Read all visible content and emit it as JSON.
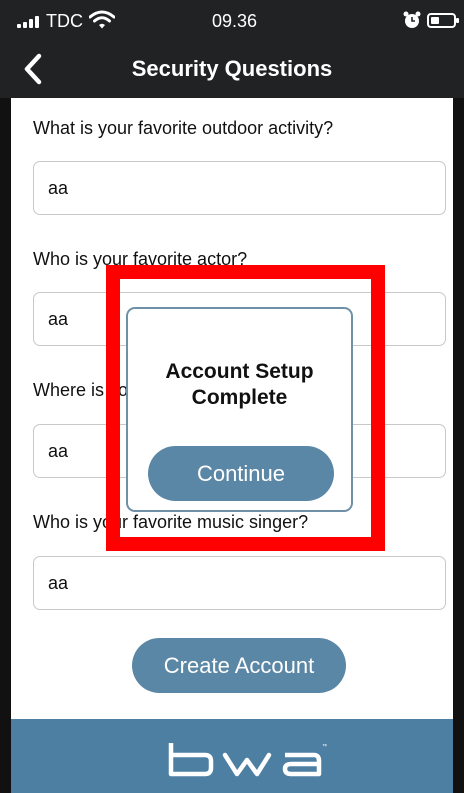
{
  "status_bar": {
    "carrier": "TDC",
    "time": "09.36"
  },
  "header": {
    "title": "Security Questions"
  },
  "questions": [
    {
      "label": "What is your favorite outdoor activity?",
      "answer": "aa"
    },
    {
      "label": "Who is your favorite actor?",
      "answer": "aa"
    },
    {
      "label": "Where is your favorite vacation spot?",
      "answer": "aa"
    },
    {
      "label": "Who is your favorite music singer?",
      "answer": "aa"
    }
  ],
  "create_button": "Create Account",
  "dialog": {
    "title": "Account Setup Complete",
    "button": "Continue"
  },
  "footer": {
    "logo_text": "bwa"
  },
  "colors": {
    "header_bg": "#202223",
    "accent": "#5b87a6",
    "footer_bg": "#4d7fa2",
    "highlight": "#ff0000"
  },
  "icons": {
    "back": "chevron-left-icon",
    "wifi": "wifi-icon",
    "alarm": "alarm-clock-icon",
    "battery": "battery-icon",
    "signal": "signal-bars-icon"
  }
}
